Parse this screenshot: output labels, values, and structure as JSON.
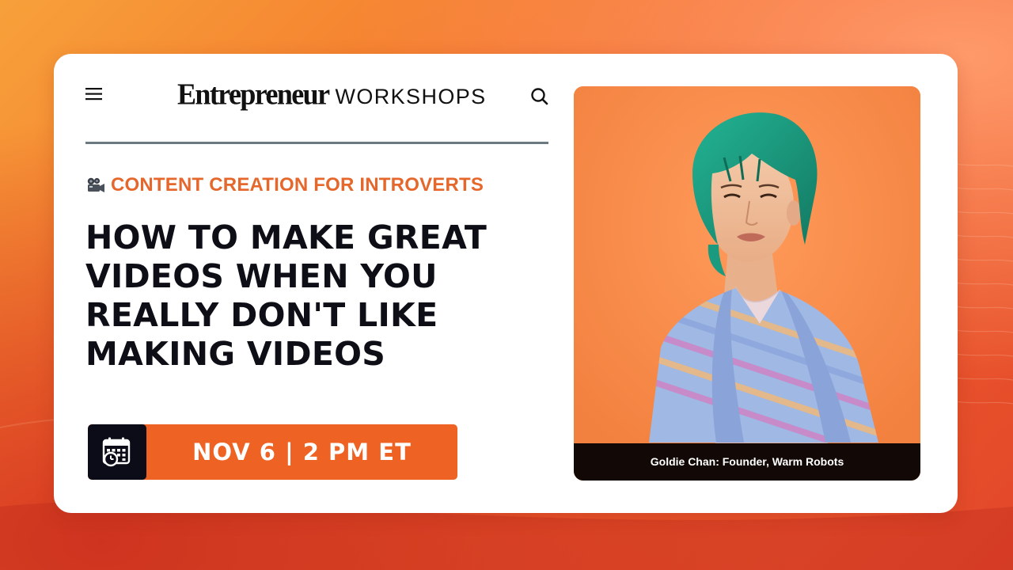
{
  "brand": {
    "name": "Entrepreneur",
    "sub": "WORKSHOPS"
  },
  "header": {
    "menu_icon": "hamburger-menu-icon",
    "search_icon": "search-icon"
  },
  "category": {
    "icon": "movie-camera-icon",
    "label": "CONTENT CREATION FOR INTROVERTS"
  },
  "headline": {
    "lines": [
      "HOW TO MAKE GREAT",
      "VIDEOS WHEN YOU",
      "REALLY DON'T LIKE",
      "MAKING VIDEOS"
    ]
  },
  "event": {
    "icon": "calendar-clock-icon",
    "date_label": "NOV 6 | 2 PM ET"
  },
  "speaker": {
    "caption": "Goldie Chan: Founder, Warm Robots"
  },
  "colors": {
    "accent": "#ee6223",
    "category_text": "#e6672c",
    "headline_text": "#0e0e16",
    "photo_background": "#f58a4a",
    "hair": "#1a9a7e",
    "divider": "#6a7a80"
  }
}
